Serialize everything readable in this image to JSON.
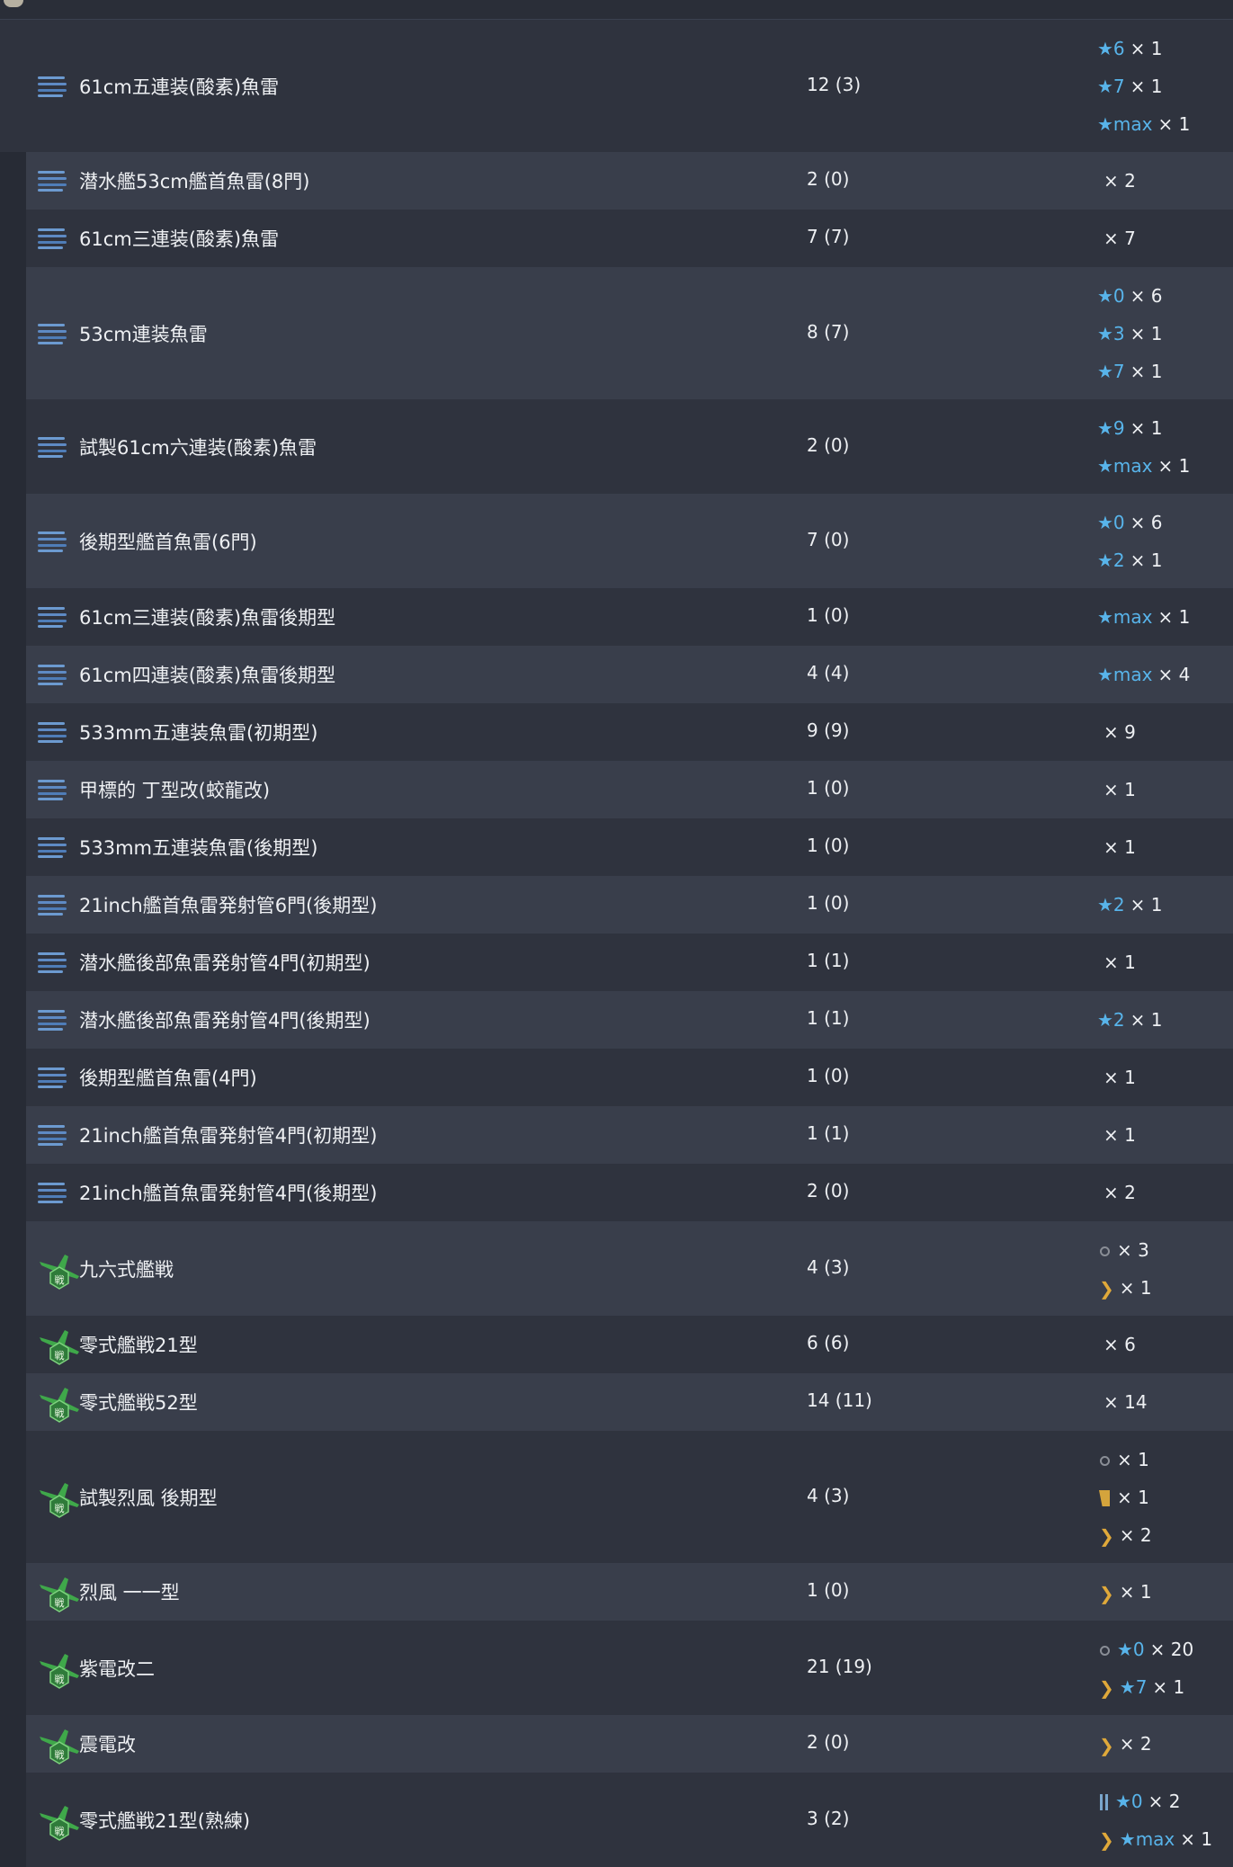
{
  "rows": [
    {
      "name": "61cm五連装(酸素)魚雷",
      "count": "12 (3)",
      "icon": "torpedo-icon",
      "prof": [
        {
          "mark": "",
          "star": "★6",
          "qty": "× 1"
        },
        {
          "mark": "",
          "star": "★7",
          "qty": "× 1"
        },
        {
          "mark": "",
          "star": "★max",
          "qty": "× 1"
        }
      ]
    },
    {
      "name": "潜水艦53cm艦首魚雷(8門)",
      "count": "2 (0)",
      "icon": "torpedo-icon",
      "prof": [
        {
          "mark": "",
          "star": "",
          "qty": "× 2"
        }
      ]
    },
    {
      "name": "61cm三連装(酸素)魚雷",
      "count": "7 (7)",
      "icon": "torpedo-icon",
      "prof": [
        {
          "mark": "",
          "star": "",
          "qty": "× 7"
        }
      ]
    },
    {
      "name": "53cm連装魚雷",
      "count": "8 (7)",
      "icon": "torpedo-icon",
      "prof": [
        {
          "mark": "",
          "star": "★0",
          "qty": "× 6"
        },
        {
          "mark": "",
          "star": "★3",
          "qty": "× 1"
        },
        {
          "mark": "",
          "star": "★7",
          "qty": "× 1"
        }
      ]
    },
    {
      "name": "試製61cm六連装(酸素)魚雷",
      "count": "2 (0)",
      "icon": "torpedo-icon",
      "prof": [
        {
          "mark": "",
          "star": "★9",
          "qty": "× 1"
        },
        {
          "mark": "",
          "star": "★max",
          "qty": "× 1"
        }
      ]
    },
    {
      "name": "後期型艦首魚雷(6門)",
      "count": "7 (0)",
      "icon": "torpedo-icon",
      "prof": [
        {
          "mark": "",
          "star": "★0",
          "qty": "× 6"
        },
        {
          "mark": "",
          "star": "★2",
          "qty": "× 1"
        }
      ]
    },
    {
      "name": "61cm三連装(酸素)魚雷後期型",
      "count": "1 (0)",
      "icon": "torpedo-icon",
      "prof": [
        {
          "mark": "",
          "star": "★max",
          "qty": "× 1"
        }
      ]
    },
    {
      "name": "61cm四連装(酸素)魚雷後期型",
      "count": "4 (4)",
      "icon": "torpedo-icon",
      "prof": [
        {
          "mark": "",
          "star": "★max",
          "qty": "× 4"
        }
      ]
    },
    {
      "name": "533mm五連装魚雷(初期型)",
      "count": "9 (9)",
      "icon": "torpedo-icon",
      "prof": [
        {
          "mark": "",
          "star": "",
          "qty": "× 9"
        }
      ]
    },
    {
      "name": "甲標的 丁型改(蛟龍改)",
      "count": "1 (0)",
      "icon": "torpedo-icon",
      "prof": [
        {
          "mark": "",
          "star": "",
          "qty": "× 1"
        }
      ]
    },
    {
      "name": "533mm五連装魚雷(後期型)",
      "count": "1 (0)",
      "icon": "torpedo-icon",
      "prof": [
        {
          "mark": "",
          "star": "",
          "qty": "× 1"
        }
      ]
    },
    {
      "name": "21inch艦首魚雷発射管6門(後期型)",
      "count": "1 (0)",
      "icon": "torpedo-icon",
      "prof": [
        {
          "mark": "",
          "star": "★2",
          "qty": "× 1"
        }
      ]
    },
    {
      "name": "潜水艦後部魚雷発射管4門(初期型)",
      "count": "1 (1)",
      "icon": "torpedo-icon",
      "prof": [
        {
          "mark": "",
          "star": "",
          "qty": "× 1"
        }
      ]
    },
    {
      "name": "潜水艦後部魚雷発射管4門(後期型)",
      "count": "1 (1)",
      "icon": "torpedo-icon",
      "prof": [
        {
          "mark": "",
          "star": "★2",
          "qty": "× 1"
        }
      ]
    },
    {
      "name": "後期型艦首魚雷(4門)",
      "count": "1 (0)",
      "icon": "torpedo-icon",
      "prof": [
        {
          "mark": "",
          "star": "",
          "qty": "× 1"
        }
      ]
    },
    {
      "name": "21inch艦首魚雷発射管4門(初期型)",
      "count": "1 (1)",
      "icon": "torpedo-icon",
      "prof": [
        {
          "mark": "",
          "star": "",
          "qty": "× 1"
        }
      ]
    },
    {
      "name": "21inch艦首魚雷発射管4門(後期型)",
      "count": "2 (0)",
      "icon": "torpedo-icon",
      "prof": [
        {
          "mark": "",
          "star": "",
          "qty": "× 2"
        }
      ]
    },
    {
      "name": "九六式艦戦",
      "count": "4 (3)",
      "icon": "fighter-icon",
      "prof": [
        {
          "mark": "ring",
          "star": "",
          "qty": "× 3"
        },
        {
          "mark": "chevron",
          "star": "",
          "qty": "× 1"
        }
      ]
    },
    {
      "name": "零式艦戦21型",
      "count": "6 (6)",
      "icon": "fighter-icon",
      "prof": [
        {
          "mark": "",
          "star": "",
          "qty": "× 6"
        }
      ]
    },
    {
      "name": "零式艦戦52型",
      "count": "14 (11)",
      "icon": "fighter-icon",
      "prof": [
        {
          "mark": "",
          "star": "",
          "qty": "× 14"
        }
      ]
    },
    {
      "name": "試製烈風 後期型",
      "count": "4 (3)",
      "icon": "fighter-icon",
      "prof": [
        {
          "mark": "ring",
          "star": "",
          "qty": "× 1"
        },
        {
          "mark": "bar",
          "star": "",
          "qty": "× 1"
        },
        {
          "mark": "chevron",
          "star": "",
          "qty": "× 2"
        }
      ]
    },
    {
      "name": "烈風 一一型",
      "count": "1 (0)",
      "icon": "fighter-icon",
      "prof": [
        {
          "mark": "chevron",
          "star": "",
          "qty": "× 1"
        }
      ]
    },
    {
      "name": "紫電改二",
      "count": "21 (19)",
      "icon": "fighter-icon",
      "prof": [
        {
          "mark": "ring",
          "star": "★0",
          "qty": "× 20"
        },
        {
          "mark": "chevron",
          "star": "★7",
          "qty": "× 1"
        }
      ]
    },
    {
      "name": "震電改",
      "count": "2 (0)",
      "icon": "fighter-icon",
      "prof": [
        {
          "mark": "chevron",
          "star": "",
          "qty": "× 2"
        }
      ]
    },
    {
      "name": "零式艦戦21型(熟練)",
      "count": "3 (2)",
      "icon": "fighter-icon",
      "prof": [
        {
          "mark": "double-bar",
          "star": "★0",
          "qty": "× 2"
        },
        {
          "mark": "chevron",
          "star": "★max",
          "qty": "× 1"
        }
      ]
    }
  ],
  "colors": {
    "star": "#58b4ea",
    "chevron": "#e0a93a",
    "row_dark": "#2f333e",
    "row_light": "#393e4b"
  }
}
